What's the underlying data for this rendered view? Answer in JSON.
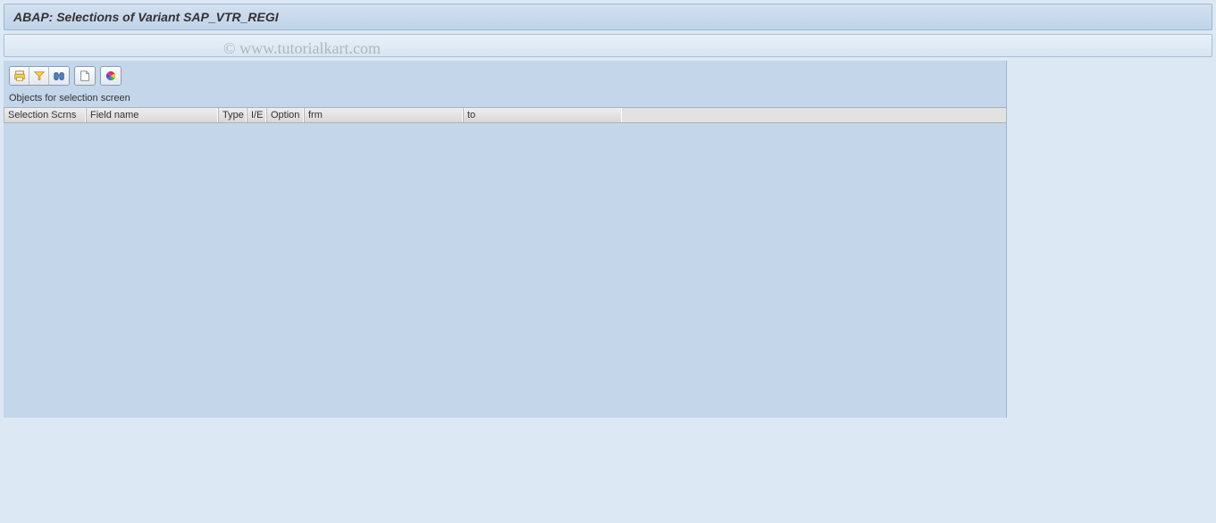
{
  "title": "ABAP: Selections of Variant SAP_VTR_REGI",
  "section_label": "Objects for selection screen",
  "toolbar": {
    "icons": [
      "print-icon",
      "filter-icon",
      "columns-icon",
      "export-icon",
      "chart-icon"
    ]
  },
  "columns": {
    "selection_scrns": "Selection Scrns",
    "field_name": "Field name",
    "type": "Type",
    "ie": "I/E",
    "option": "Option",
    "frm": "frm",
    "to": "to"
  },
  "watermark": "© www.tutorialkart.com"
}
